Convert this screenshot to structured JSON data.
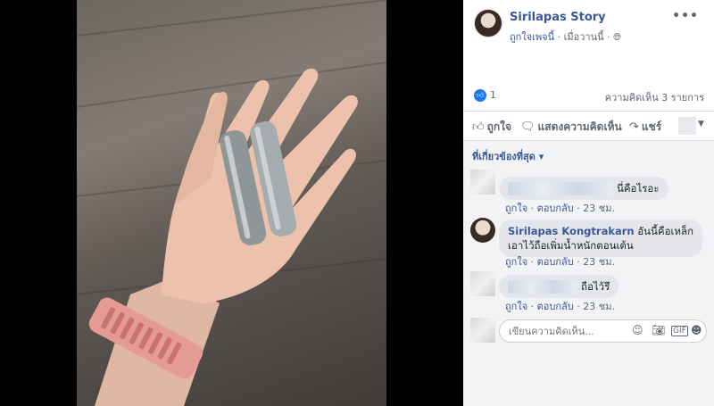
{
  "post": {
    "page_name": "Sirilapas Story",
    "liked_label": "ถูกใจเพจนี้",
    "separator": " · ",
    "time": "เมื่อวานนี้",
    "more": "•••",
    "like_count": "1",
    "comment_count": "ความคิดเห็น 3 รายการ"
  },
  "actions": {
    "like": "ถูกใจ",
    "comment": "แสดงความคิดเห็น",
    "share": "แชร์"
  },
  "comments": {
    "filter": "ที่เกี่ยวข้องที่สุด ▾",
    "items": [
      {
        "author": "",
        "text": "นี่คือไรอะ",
        "like": "ถูกใจ",
        "reply": "ตอบกลับ",
        "time": "23 ชม."
      },
      {
        "author": "Sirilapas Kongtrakarn",
        "text_line1": "อันนี้คือเหล็ก",
        "text_line2": "เอาไว้ถือเพิ่มน้ำหนักตอนเต้น",
        "like": "ถูกใจ",
        "reply": "ตอบกลับ",
        "time": "23 ชม."
      },
      {
        "author": "",
        "text": "ถือไว้รึ",
        "like": "ถูกใจ",
        "reply": "ตอบกลับ",
        "time": "23 ชม."
      }
    ],
    "compose_placeholder": "เขียนความคิดเห็น..."
  },
  "icons": {
    "like": "thumbs-up-icon",
    "comment": "comment-icon",
    "share": "share-icon",
    "globe": "globe-icon",
    "emoji": "emoji-icon",
    "camera": "camera-icon",
    "gif": "gif-icon",
    "sticker": "sticker-icon"
  },
  "colors": {
    "link": "#385898",
    "like_blue": "#1877f2",
    "comment_bg": "#f2f3f5",
    "bubble_bg": "#e4e6eb"
  }
}
